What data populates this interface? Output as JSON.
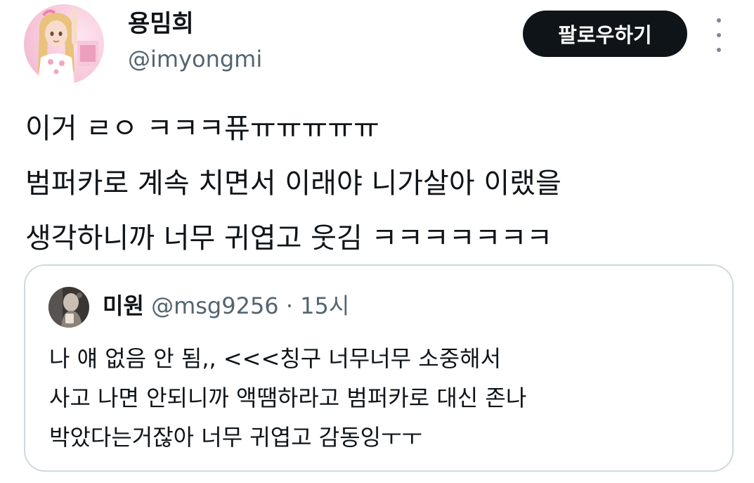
{
  "author": {
    "display_name": "용밈희",
    "handle": "@imyongmi"
  },
  "actions": {
    "follow_label": "팔로우하기",
    "more_icon": "more-vertical-icon"
  },
  "tweet": {
    "lines": [
      "이거 ㄹㅇ ㅋㅋㅋ퓨ㅠㅠㅠㅠㅠ",
      "범퍼카로 계속 치면서 이래야 니가살아 이랬을",
      "생각하니까 너무 귀엽고 웃김 ㅋㅋㅋㅋㅋㅋㅋ"
    ]
  },
  "quote": {
    "display_name": "미원",
    "handle": "@msg9256",
    "separator": "·",
    "time": "15시",
    "lines": [
      "나 얘 없음 안 됨,, <<<칭구 너무너무 소중해서",
      "사고 나면 안되니까 액땜하라고 범퍼카로 대신 존나",
      "박았다는거잖아 너무 귀엽고 감동잉ㅜㅜ"
    ]
  },
  "colors": {
    "text_primary": "#0f1419",
    "text_secondary": "#536471",
    "border": "#cfd9de",
    "follow_bg": "#0f1419",
    "follow_text": "#ffffff"
  }
}
